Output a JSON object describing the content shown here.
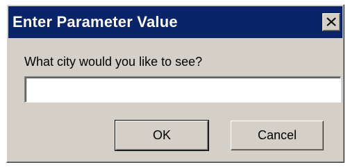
{
  "dialog": {
    "title": "Enter Parameter Value",
    "close_icon": "close-icon",
    "prompt": "What city would you like to see?",
    "input": {
      "value": "",
      "placeholder": ""
    },
    "buttons": {
      "ok_label": "OK",
      "cancel_label": "Cancel"
    }
  },
  "colors": {
    "titlebar": "#0a246a",
    "face": "#d4d0c8"
  }
}
